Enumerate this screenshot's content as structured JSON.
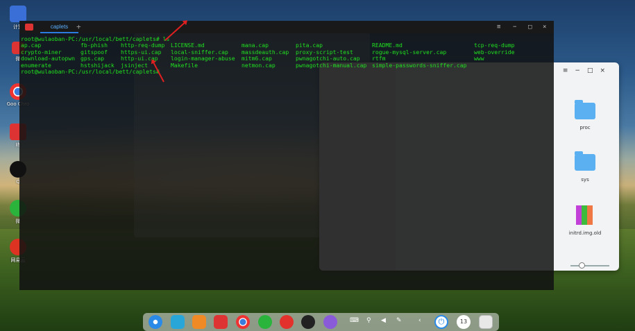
{
  "desktop": {
    "icons": [
      {
        "name": "computer",
        "label": "计算",
        "color": "#3a6fd8"
      },
      {
        "name": "terminal",
        "label": "终",
        "color": "#d33"
      },
      {
        "name": "chrome",
        "label": "Goo Chro",
        "color": "#e33"
      },
      {
        "name": "terminal2",
        "label": "终",
        "color": "#c33"
      },
      {
        "name": "qq",
        "label": "Q",
        "color": "#111"
      },
      {
        "name": "wechat",
        "label": "微",
        "color": "#2bb43c"
      },
      {
        "name": "netease",
        "label": "网易云",
        "color": "#d32"
      }
    ]
  },
  "terminal": {
    "tab_label": "caplets",
    "add_tab": "+",
    "controls": {
      "menu": "≡",
      "min": "−",
      "max": "□",
      "close": "×"
    },
    "prompt_line": "root@wulaoban-PC:/usr/local/bett/caplets# ls",
    "columns": [
      [
        "ap.cap",
        "crypto-miner",
        "download-autopwn",
        "enumerate"
      ],
      [
        "fb-phish",
        "gitspoof",
        "gps.cap",
        "hstshijack"
      ],
      [
        "http-req-dump",
        "https-ui.cap",
        "http-ui.cap",
        "jsinject"
      ],
      [
        "LICENSE.md",
        "local-sniffer.cap",
        "login-manager-abuse",
        "Makefile"
      ],
      [
        "mana.cap",
        "massdeauth.cap",
        "mitm6.cap",
        "netmon.cap"
      ],
      [
        "pita.cap",
        "proxy-script-test",
        "pwnagotchi-auto.cap",
        "pwnagotchi-manual.cap"
      ],
      [
        "README.md",
        "rogue-mysql-server.cap",
        "rtfm",
        "simple-passwords-sniffer.cap"
      ],
      [
        "tcp-req-dump",
        "web-override",
        "www",
        ""
      ]
    ],
    "last_prompt": "root@wulaoban-PC:/usr/local/bett/caplets#"
  },
  "file_manager": {
    "controls": {
      "menu": "≡",
      "min": "−",
      "max": "□",
      "close": "×"
    },
    "folders": [
      "proc",
      "sys",
      "initrd.img.old"
    ]
  },
  "dock": {
    "apps": [
      "launcher",
      "file-manager",
      "archive",
      "terminal",
      "chrome",
      "wechat",
      "netease",
      "qq",
      "settings"
    ],
    "tray": [
      "keyboard",
      "usb",
      "volume",
      "pen",
      "expand"
    ],
    "power": "⏻",
    "clock": "13"
  }
}
